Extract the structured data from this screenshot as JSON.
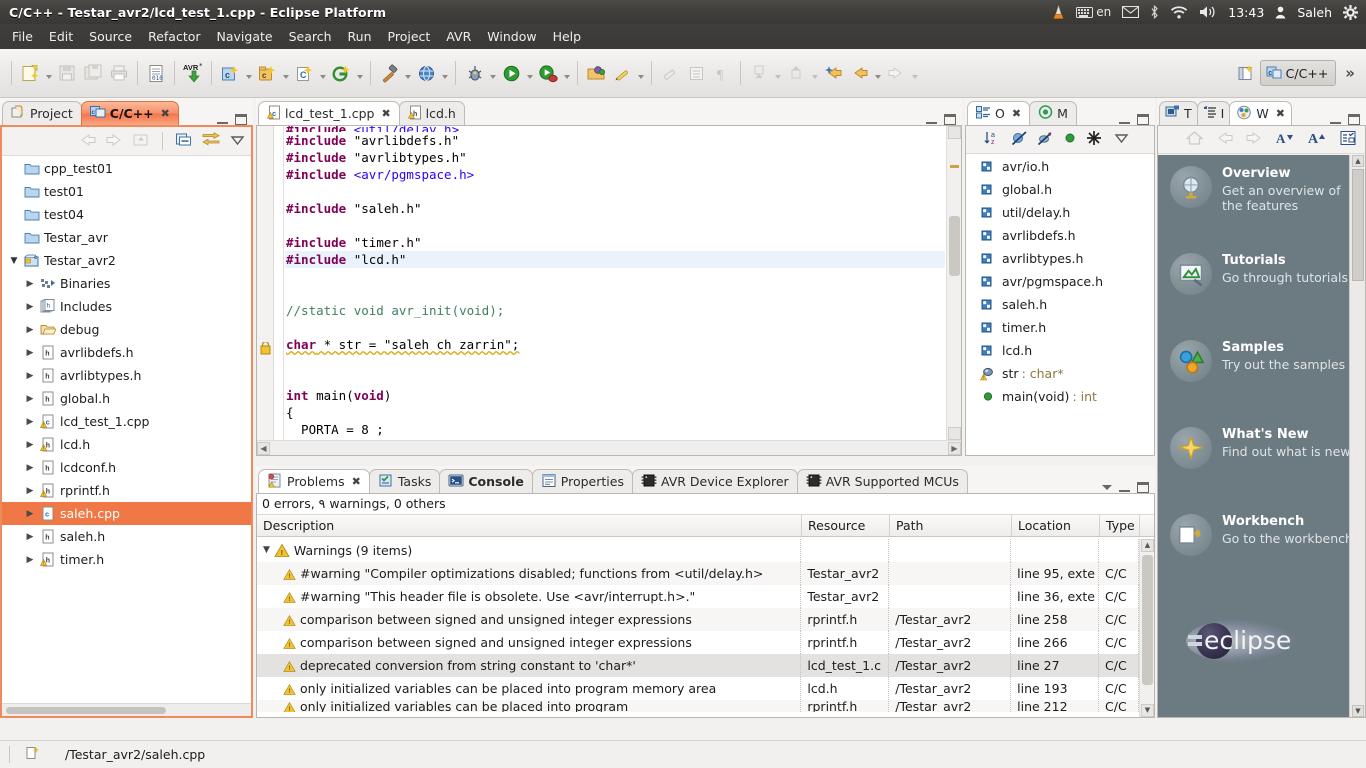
{
  "window": {
    "title": "C/C++ - Testar_avr2/lcd_test_1.cpp - Eclipse Platform"
  },
  "tray": {
    "keyboard_lang": "en",
    "clock": "13:43",
    "user": "Saleh"
  },
  "menubar": {
    "items": [
      "File",
      "Edit",
      "Source",
      "Refactor",
      "Navigate",
      "Search",
      "Run",
      "Project",
      "AVR",
      "Window",
      "Help"
    ]
  },
  "toolbar": {
    "perspective_label": "C/C++",
    "overflow_label": "»"
  },
  "project_explorer": {
    "tabs": [
      {
        "label": "Project",
        "active": false,
        "closable": false
      },
      {
        "label": "C/C++",
        "active": true,
        "closable": true
      }
    ],
    "tree": [
      {
        "label": "cpp_test01",
        "icon": "folder-icon",
        "depth": 0,
        "arrow": "none",
        "selected": false
      },
      {
        "label": "test01",
        "icon": "folder-icon",
        "depth": 0,
        "arrow": "none",
        "selected": false
      },
      {
        "label": "test04",
        "icon": "folder-icon",
        "depth": 0,
        "arrow": "none",
        "selected": false
      },
      {
        "label": "Testar_avr",
        "icon": "folder-icon",
        "depth": 0,
        "arrow": "none",
        "selected": false
      },
      {
        "label": "Testar_avr2",
        "icon": "cproject-icon",
        "depth": 0,
        "arrow": "open",
        "selected": false
      },
      {
        "label": "Binaries",
        "icon": "binaries-icon",
        "depth": 1,
        "arrow": "closed",
        "selected": false
      },
      {
        "label": "Includes",
        "icon": "includes-icon",
        "depth": 1,
        "arrow": "closed",
        "selected": false
      },
      {
        "label": "debug",
        "icon": "folder-open-icon",
        "depth": 1,
        "arrow": "closed",
        "selected": false
      },
      {
        "label": "avrlibdefs.h",
        "icon": "header-file-icon",
        "depth": 1,
        "arrow": "closed",
        "selected": false
      },
      {
        "label": "avrlibtypes.h",
        "icon": "header-file-icon",
        "depth": 1,
        "arrow": "closed",
        "selected": false
      },
      {
        "label": "global.h",
        "icon": "header-file-icon",
        "depth": 1,
        "arrow": "closed",
        "selected": false
      },
      {
        "label": "lcd_test_1.cpp",
        "icon": "cpp-file-warning-icon",
        "depth": 1,
        "arrow": "closed",
        "selected": false
      },
      {
        "label": "lcd.h",
        "icon": "header-file-warning-icon",
        "depth": 1,
        "arrow": "closed",
        "selected": false
      },
      {
        "label": "lcdconf.h",
        "icon": "header-file-icon",
        "depth": 1,
        "arrow": "closed",
        "selected": false
      },
      {
        "label": "rprintf.h",
        "icon": "header-file-warning-icon",
        "depth": 1,
        "arrow": "closed",
        "selected": false
      },
      {
        "label": "saleh.cpp",
        "icon": "cpp-file-icon",
        "depth": 1,
        "arrow": "closed",
        "selected": true
      },
      {
        "label": "saleh.h",
        "icon": "header-file-icon",
        "depth": 1,
        "arrow": "closed",
        "selected": false
      },
      {
        "label": "timer.h",
        "icon": "header-file-warning-icon",
        "depth": 1,
        "arrow": "closed",
        "selected": false
      }
    ]
  },
  "editor": {
    "tabs": [
      {
        "label": "lcd_test_1.cpp",
        "active": true,
        "closable": true,
        "icon": "cpp-file-warning-icon"
      },
      {
        "label": "lcd.h",
        "active": false,
        "closable": false,
        "icon": "header-file-warning-icon"
      }
    ],
    "lines": [
      {
        "text": "#include <util/delay.h>",
        "clipped": true
      },
      {
        "text": "#include \"avrlibdefs.h\""
      },
      {
        "text": "#include \"avrlibtypes.h\""
      },
      {
        "text": "#include <avr/pgmspace.h>"
      },
      {
        "text": ""
      },
      {
        "text": "#include \"saleh.h\""
      },
      {
        "text": ""
      },
      {
        "text": "#include \"timer.h\""
      },
      {
        "text": "#include \"lcd.h\"",
        "highlighted": true
      },
      {
        "text": ""
      },
      {
        "text": ""
      },
      {
        "text": "//static void avr_init(void);",
        "comment": true
      },
      {
        "text": ""
      },
      {
        "text": "char * str = \"saleh ch zarrin\";",
        "warning": true
      },
      {
        "text": ""
      },
      {
        "text": ""
      },
      {
        "text": "int main(void)"
      },
      {
        "text": "{"
      },
      {
        "text": "  PORTA = 8 ;"
      }
    ]
  },
  "outline": {
    "tabs": [
      {
        "label": "O",
        "active": true,
        "closable": true,
        "icon": "outline-icon"
      },
      {
        "label": "M",
        "active": false,
        "closable": false,
        "icon": "make-target-icon"
      }
    ],
    "items": [
      {
        "label": "avr/io.h",
        "icon": "include-icon"
      },
      {
        "label": "global.h",
        "icon": "include-icon"
      },
      {
        "label": "util/delay.h",
        "icon": "include-icon"
      },
      {
        "label": "avrlibdefs.h",
        "icon": "include-icon"
      },
      {
        "label": "avrlibtypes.h",
        "icon": "include-icon"
      },
      {
        "label": "avr/pgmspace.h",
        "icon": "include-icon"
      },
      {
        "label": "saleh.h",
        "icon": "include-icon"
      },
      {
        "label": "timer.h",
        "icon": "include-icon"
      },
      {
        "label": "lcd.h",
        "icon": "include-icon"
      },
      {
        "label": "str",
        "type": " : char*",
        "icon": "variable-warning-icon"
      },
      {
        "label": "main(void)",
        "type": " : int",
        "icon": "function-icon"
      }
    ]
  },
  "welcome": {
    "tabs": [
      {
        "label": "T",
        "active": false,
        "closable": false,
        "icon": "task-list-icon"
      },
      {
        "label": "I",
        "active": false,
        "closable": false,
        "icon": "outline-tree-icon"
      },
      {
        "label": "W",
        "active": true,
        "closable": true,
        "icon": "welcome-icon"
      }
    ],
    "items": [
      {
        "title": "Overview",
        "desc": "Get an overview of the features",
        "icon": "globe-icon"
      },
      {
        "title": "Tutorials",
        "desc": "Go through tutorials",
        "icon": "tutorials-icon"
      },
      {
        "title": "Samples",
        "desc": "Try out the samples",
        "icon": "samples-icon"
      },
      {
        "title": "What's New",
        "desc": "Find out what is new",
        "icon": "star-icon"
      },
      {
        "title": "Workbench",
        "desc": "Go to the workbench",
        "icon": "workbench-icon"
      }
    ],
    "brand": "eclipse"
  },
  "problems": {
    "tabs": [
      {
        "label": "Problems",
        "active": true,
        "closable": true,
        "icon": "problems-icon"
      },
      {
        "label": "Tasks",
        "active": false,
        "closable": false,
        "icon": "tasks-icon"
      },
      {
        "label": "Console",
        "active": false,
        "bold": true,
        "closable": false,
        "icon": "console-icon"
      },
      {
        "label": "Properties",
        "active": false,
        "closable": false,
        "icon": "properties-icon"
      },
      {
        "label": "AVR Device Explorer",
        "active": false,
        "closable": false,
        "icon": "avr-icon"
      },
      {
        "label": "AVR Supported MCUs",
        "active": false,
        "closable": false,
        "icon": "avr-icon"
      }
    ],
    "summary": "0 errors, ٩ warnings, 0 others",
    "columns": [
      "Description",
      "Resource",
      "Path",
      "Location",
      "Type"
    ],
    "group": {
      "label": "Warnings (9 items)",
      "icon": "warning-icon"
    },
    "rows": [
      {
        "description": "#warning \"Compiler optimizations disabled; functions from <util/delay.h>",
        "resource": "Testar_avr2",
        "path": "",
        "location": "line 95, exte",
        "type": "C/C",
        "selected": false
      },
      {
        "description": "#warning \"This header file is obsolete.  Use <avr/interrupt.h>.\"",
        "resource": "Testar_avr2",
        "path": "",
        "location": "line 36, exte",
        "type": "C/C",
        "selected": false
      },
      {
        "description": "comparison between signed and unsigned integer expressions",
        "resource": "rprintf.h",
        "path": "/Testar_avr2",
        "location": "line 258",
        "type": "C/C",
        "selected": false
      },
      {
        "description": "comparison between signed and unsigned integer expressions",
        "resource": "rprintf.h",
        "path": "/Testar_avr2",
        "location": "line 266",
        "type": "C/C",
        "selected": false
      },
      {
        "description": "deprecated conversion from string constant to 'char*'",
        "resource": "lcd_test_1.c",
        "path": "/Testar_avr2",
        "location": "line 27",
        "type": "C/C",
        "selected": true
      },
      {
        "description": "only initialized variables can be placed into program memory area",
        "resource": "lcd.h",
        "path": "/Testar_avr2",
        "location": "line 193",
        "type": "C/C",
        "selected": false
      },
      {
        "description": "only initialized variables can be placed into program",
        "resource": "rprintf.h",
        "path": "/Testar_avr2",
        "location": "line 212",
        "type": "C/C",
        "selected": false,
        "clipped": true
      }
    ]
  },
  "statusbar": {
    "path": "/Testar_avr2/saleh.cpp"
  },
  "colors": {
    "accent": "#f07746",
    "titlebar": "#403e3b",
    "welcome_bg": "#6b7b81",
    "keyword": "#7f0055",
    "string": "#2a00ff",
    "comment": "#3f7f5f"
  }
}
